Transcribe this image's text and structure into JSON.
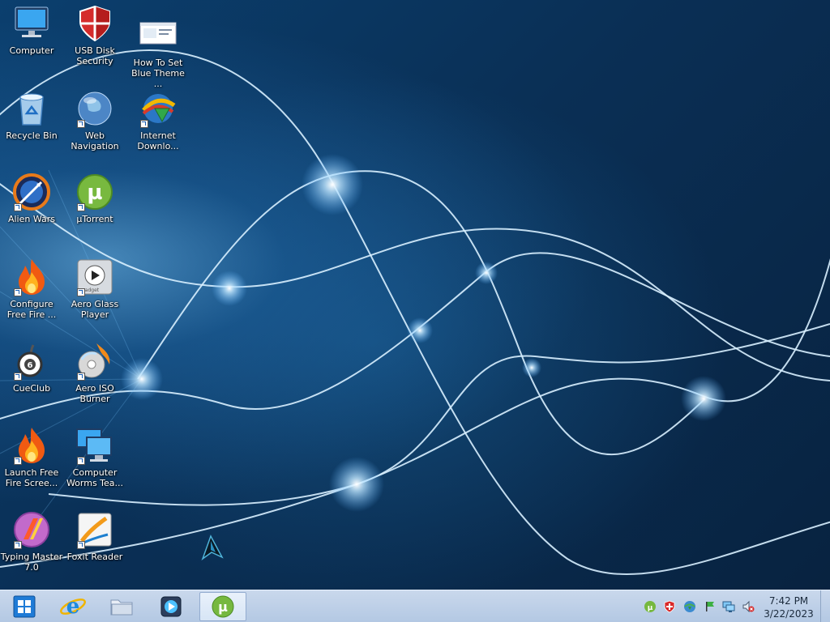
{
  "desktop": {
    "icons": [
      {
        "name": "computer",
        "label": "Computer",
        "icon": "computer-icon"
      },
      {
        "name": "usb-disk-security",
        "label": "USB Disk\nSecurity",
        "icon": "shield-icon"
      },
      {
        "name": "how-to-set-blue-theme",
        "label": "How To Set\nBlue Theme ...",
        "icon": "document-thumbnail-icon"
      },
      {
        "name": "recycle-bin",
        "label": "Recycle Bin",
        "icon": "recycle-bin-icon"
      },
      {
        "name": "web-navigation",
        "label": "Web\nNavigation",
        "icon": "globe-icon"
      },
      {
        "name": "internet-download-manager",
        "label": "Internet\nDownlo...",
        "icon": "download-globe-icon"
      },
      {
        "name": "alien-wars",
        "label": "Alien Wars",
        "icon": "alien-wars-icon"
      },
      {
        "name": "utorrent",
        "label": "µTorrent",
        "icon": "utorrent-icon"
      },
      {
        "name": "configure-free-fire",
        "label": "Configure\nFree Fire ...",
        "icon": "flame-icon"
      },
      {
        "name": "aero-glass-player",
        "label": "Aero Glass\nPlayer",
        "icon": "media-player-icon"
      },
      {
        "name": "cueclub",
        "label": "CueClub",
        "icon": "cue-ball-icon"
      },
      {
        "name": "aero-iso-burner",
        "label": "Aero ISO\nBurner",
        "icon": "disc-burner-icon"
      },
      {
        "name": "launch-free-fire",
        "label": "Launch Free\nFire Scree...",
        "icon": "flame-icon"
      },
      {
        "name": "computer-worms-team",
        "label": "Computer\nWorms Tea...",
        "icon": "monitors-icon"
      },
      {
        "name": "typing-master",
        "label": "Typing Master\n7.0",
        "icon": "typing-master-icon"
      },
      {
        "name": "foxit-reader",
        "label": "Foxit Reader",
        "icon": "foxit-reader-icon"
      }
    ]
  },
  "taskbar": {
    "buttons": [
      {
        "name": "start",
        "icon": "windows-logo-icon"
      },
      {
        "name": "internet-explorer",
        "icon": "internet-explorer-icon"
      },
      {
        "name": "file-explorer",
        "icon": "folder-icon"
      },
      {
        "name": "media-player",
        "icon": "media-player-icon"
      },
      {
        "name": "utorrent",
        "icon": "utorrent-icon",
        "active": true
      }
    ],
    "tray": [
      "utorrent-icon",
      "shield-icon",
      "download-globe-icon",
      "flag-icon",
      "network-icon",
      "volume-muted-icon"
    ],
    "clock": {
      "time": "7:42 PM",
      "date": "3/22/2023"
    }
  },
  "colors": {
    "accent": "#1c6fb8",
    "taskbar": "#b9cce6",
    "utorrent_green": "#76b83f"
  }
}
